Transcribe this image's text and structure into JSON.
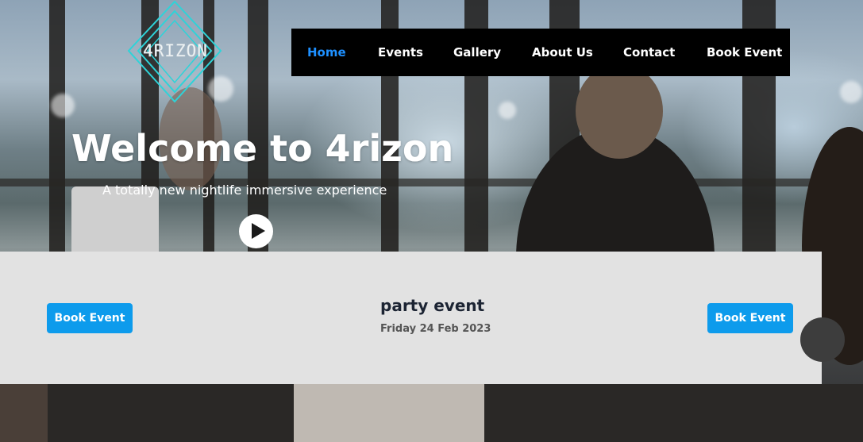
{
  "logo": {
    "text": "4RIZON"
  },
  "nav": {
    "items": [
      {
        "label": "Home",
        "active": true
      },
      {
        "label": "Events",
        "active": false
      },
      {
        "label": "Gallery",
        "active": false
      },
      {
        "label": "About Us",
        "active": false
      },
      {
        "label": "Contact",
        "active": false
      },
      {
        "label": "Book Event",
        "active": false
      }
    ]
  },
  "hero": {
    "title": "Welcome to 4rizon",
    "subtitle": "A totally new nightlife immersive experience",
    "play_icon": "play-icon"
  },
  "event": {
    "title": "party event",
    "date": "Friday 24 Feb 2023",
    "book_left_label": "Book Event",
    "book_right_label": "Book Event"
  },
  "colors": {
    "accent": "#0d9bec",
    "nav_active": "#1e90ff",
    "nav_bg": "#000000",
    "panel_bg": "#e2e2e2",
    "logo": "#2ed3d8"
  }
}
